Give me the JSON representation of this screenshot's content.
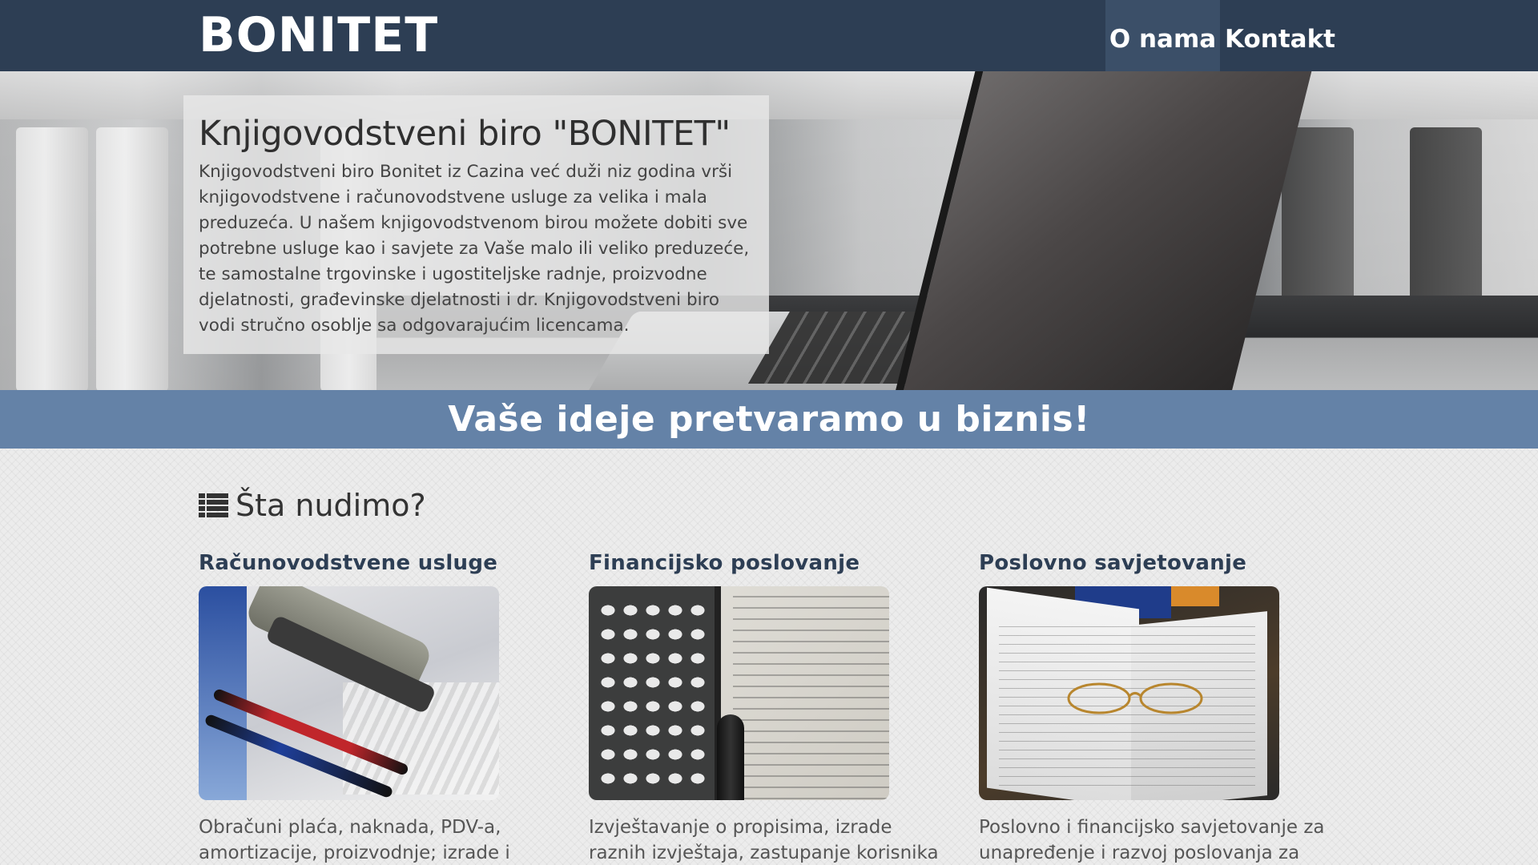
{
  "header": {
    "brand": "BONITET",
    "nav": [
      {
        "label": "O nama",
        "active": true
      },
      {
        "label": "Kontakt",
        "active": false
      }
    ]
  },
  "hero": {
    "title": "Knjigovodstveni biro \"BONITET\"",
    "text": "Knjigovodstveni biro Bonitet iz Cazina već duži niz godina vrši knjigovodstvene i računovodstvene usluge za velika i mala preduzeća. U našem knjigovodstvenom birou možete dobiti sve potrebne usluge kao i savjete za Vaše malo ili veliko preduzeće, te samostalne trgovinske i ugostiteljske radnje, proizvodne djelatnosti, građevinske djelatnosti i dr. Knjigovodstveni biro vodi stručno osoblje sa odgovarajućim licencama."
  },
  "slogan": "Vaše ideje pretvaramo u biznis!",
  "services": {
    "title": "Šta nudimo?",
    "items": [
      {
        "title": "Računovodstvene usluge",
        "text": "Obračuni plaća, naknada, PDV-a, amortizacije, proizvodnje; izrade i"
      },
      {
        "title": "Financijsko poslovanje",
        "text": "Izvještavanje o propisima, izrade raznih izvještaja, zastupanje korisnika"
      },
      {
        "title": "Poslovno savjetovanje",
        "text": "Poslovno i financijsko savjetovanje za unapređenje i razvoj poslovanja za"
      }
    ]
  },
  "colors": {
    "navbar": "#2d3e54",
    "nav_active": "#3b4f68",
    "slogan_bar": "#6482a7",
    "service_title": "#2d3e54"
  },
  "icons": {
    "section": "list-icon"
  }
}
